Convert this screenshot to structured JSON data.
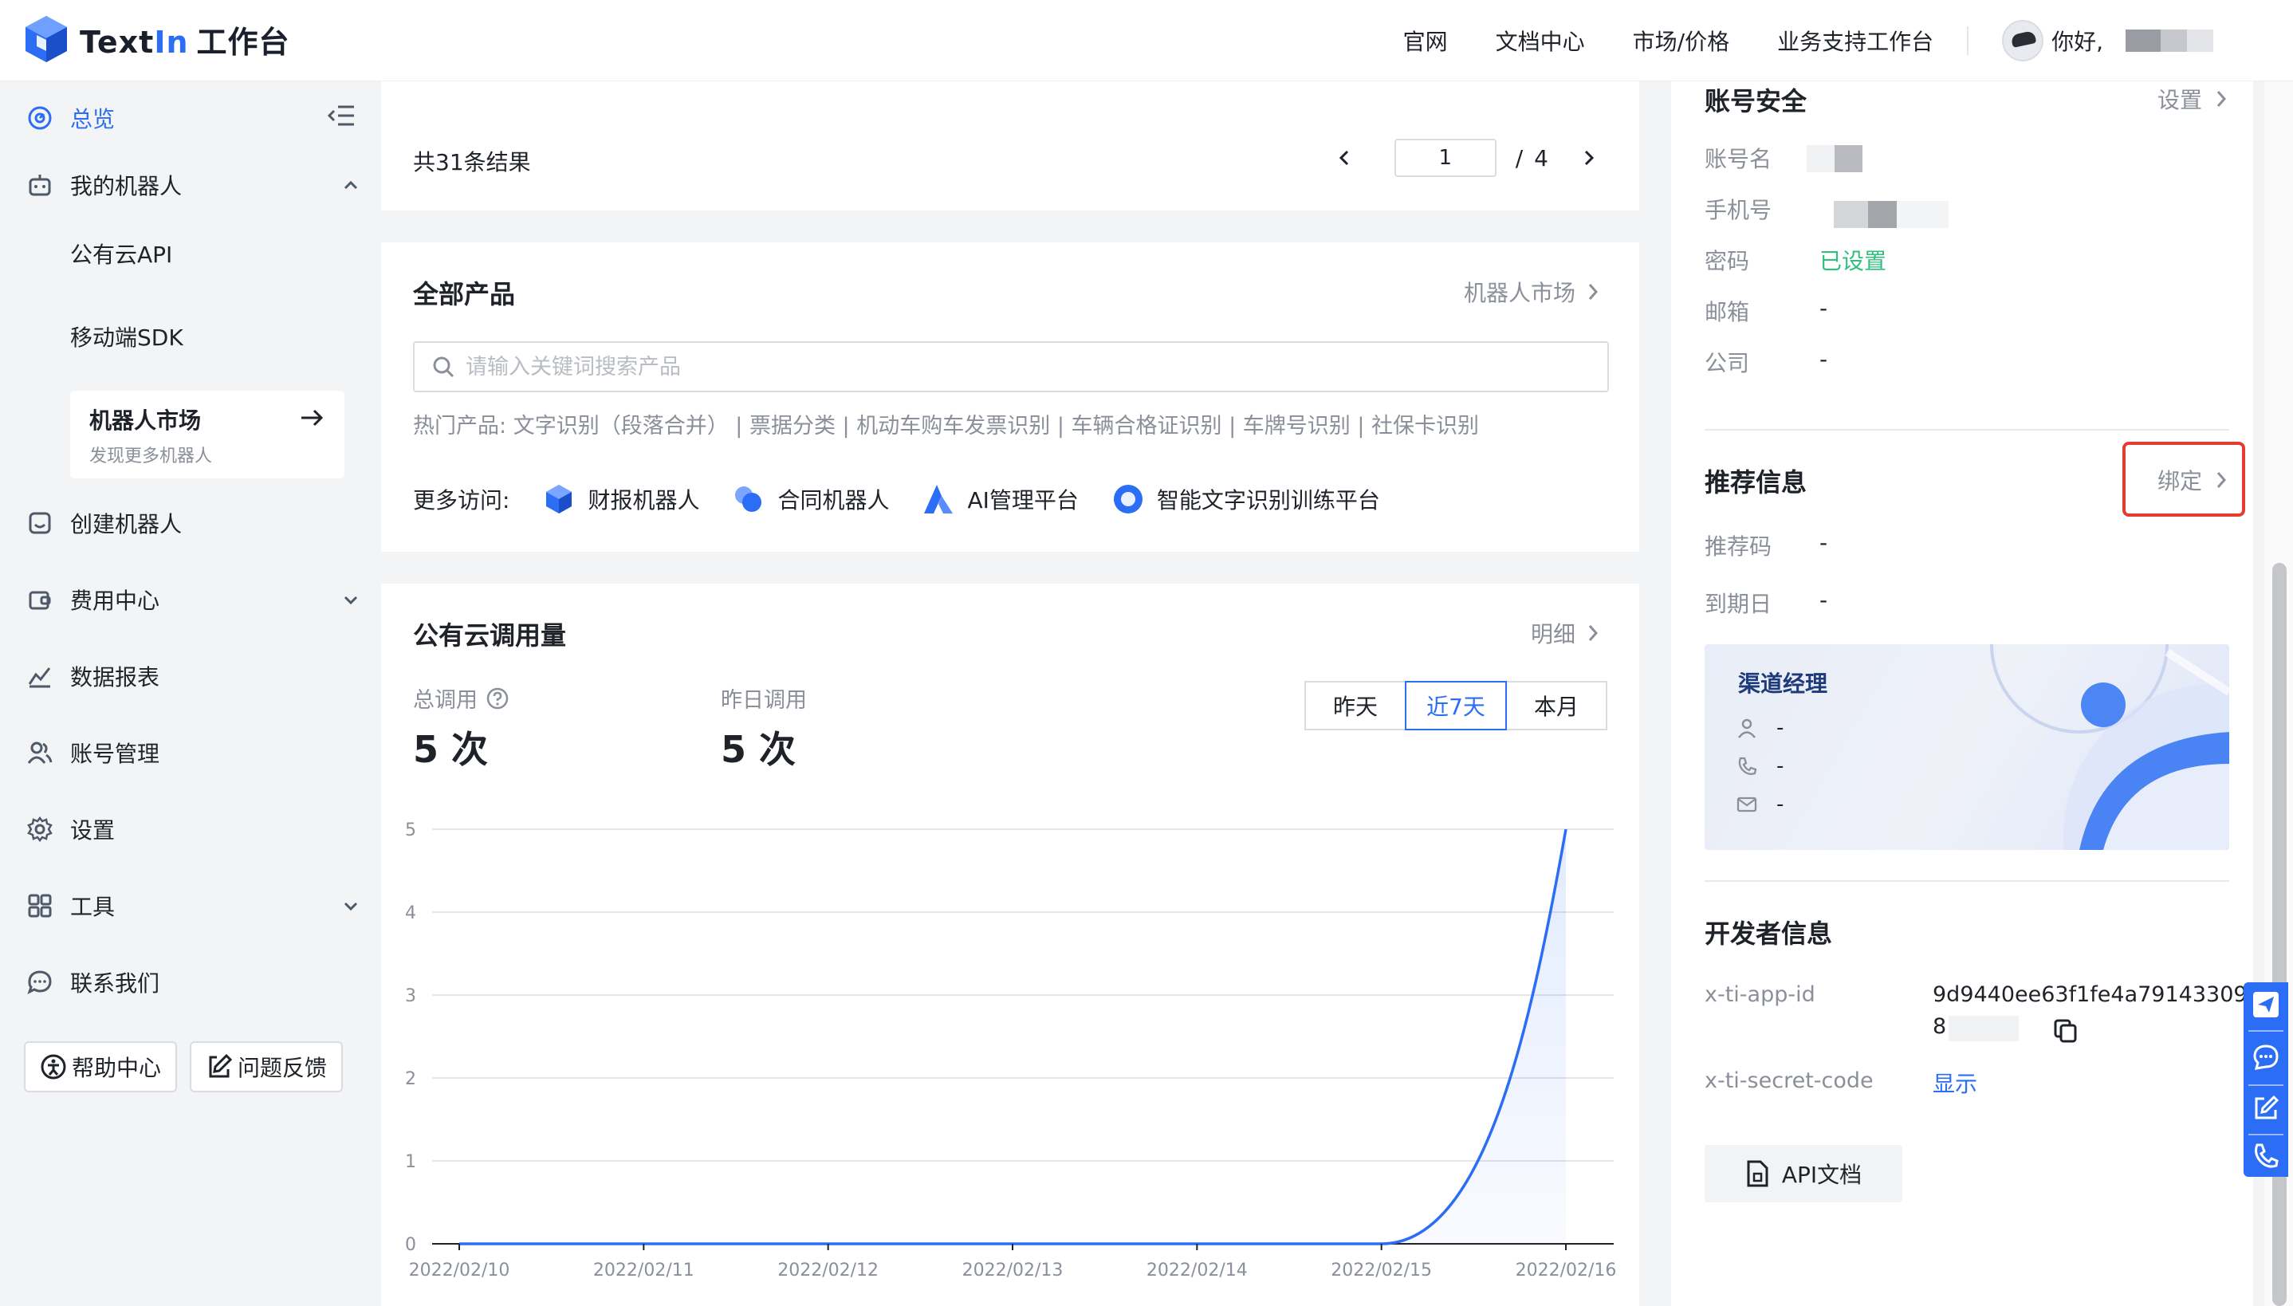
{
  "brand": {
    "name_prefix": "Text",
    "name_accent": "In",
    "name_suffix": "工作台"
  },
  "topnav": {
    "links": [
      "官网",
      "文档中心",
      "市场/价格",
      "业务支持工作台"
    ],
    "greeting": "你好,"
  },
  "sidebar": {
    "overview": "总览",
    "my_robots": "我的机器人",
    "public_api": "公有云API",
    "mobile_sdk": "移动端SDK",
    "market_title": "机器人市场",
    "market_sub": "发现更多机器人",
    "create_robot": "创建机器人",
    "billing": "费用中心",
    "reports": "数据报表",
    "account": "账号管理",
    "settings": "设置",
    "tools": "工具",
    "contact": "联系我们",
    "help_center": "帮助中心",
    "feedback": "问题反馈"
  },
  "results": {
    "summary": "共31条结果",
    "page_current": "1",
    "page_sep": "/",
    "page_total": "4"
  },
  "products": {
    "title": "全部产品",
    "market_link": "机器人市场",
    "search_placeholder": "请输入关键词搜索产品",
    "hot_label": "热门产品:",
    "hot_items": [
      "文字识别（段落合并）",
      "票据分类",
      "机动车购车发票识别",
      "车辆合格证识别",
      "车牌号识别",
      "社保卡识别"
    ],
    "more_label": "更多访问:",
    "more_items": [
      "财报机器人",
      "合同机器人",
      "AI管理平台",
      "智能文字识别训练平台"
    ]
  },
  "usage": {
    "title": "公有云调用量",
    "detail_link": "明细",
    "total_label": "总调用",
    "total_value": "5 次",
    "yesterday_label": "昨日调用",
    "yesterday_value": "5 次",
    "ranges": [
      "昨天",
      "近7天",
      "本月"
    ],
    "selected_range": "近7天"
  },
  "chart_data": {
    "type": "area",
    "title": "",
    "xlabel": "",
    "ylabel": "",
    "categories": [
      "2022/02/10",
      "2022/02/11",
      "2022/02/12",
      "2022/02/13",
      "2022/02/14",
      "2022/02/15",
      "2022/02/16"
    ],
    "values": [
      0,
      0,
      0,
      0,
      0,
      0,
      5
    ],
    "ylim": [
      0,
      5
    ],
    "yticks": [
      "0",
      "1",
      "2",
      "3",
      "4",
      "5"
    ],
    "grid": true,
    "smooth": true,
    "color": "#2c6df5"
  },
  "account_security": {
    "title": "账号安全",
    "settings_link": "设置",
    "rows": [
      {
        "label": "账号名",
        "value": ""
      },
      {
        "label": "手机号",
        "value": ""
      },
      {
        "label": "密码",
        "value": "已设置"
      },
      {
        "label": "邮箱",
        "value": "-"
      },
      {
        "label": "公司",
        "value": "-"
      }
    ]
  },
  "referral": {
    "title": "推荐信息",
    "bind_link": "绑定",
    "code_label": "推荐码",
    "code_value": "-",
    "expire_label": "到期日",
    "expire_value": "-",
    "channel_title": "渠道经理",
    "channel_name": "-",
    "channel_phone": "-",
    "channel_email": "-"
  },
  "developer": {
    "title": "开发者信息",
    "app_id_label": "x-ti-app-id",
    "app_id_line1": "9d9440ee63f1fe4a79143309",
    "app_id_line2": "8",
    "secret_label": "x-ti-secret-code",
    "secret_link": "显示",
    "api_doc": "API文档"
  },
  "colors": {
    "accent": "#2c6df5",
    "success": "#2fbf7f",
    "highlight_box": "#e43d2f"
  }
}
